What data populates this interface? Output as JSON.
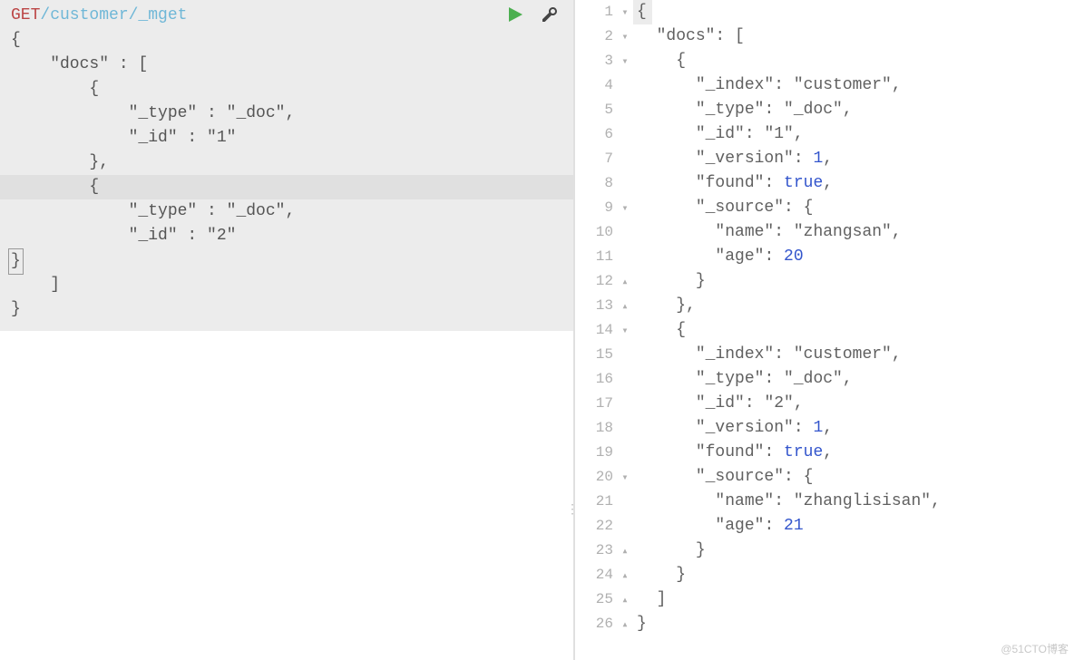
{
  "request": {
    "method": "GET",
    "path": "/customer/_mget",
    "body_lines": [
      "{",
      "    \"docs\" : [",
      "        {",
      "            \"_type\" : \"_doc\",",
      "            \"_id\" : \"1\"",
      "        },",
      "        {",
      "            \"_type\" : \"_doc\",",
      "            \"_id\" : \"2\"",
      "        }",
      "    ]",
      "}"
    ],
    "highlighted_line_index": 7
  },
  "actions": {
    "run": "run-request",
    "tools": "tools-menu"
  },
  "response": {
    "lines": [
      {
        "n": 1,
        "fold": "open",
        "indent": 0,
        "tokens": [
          {
            "t": "{",
            "c": "punc"
          }
        ],
        "hl": true
      },
      {
        "n": 2,
        "fold": "open",
        "indent": 1,
        "tokens": [
          {
            "t": "\"docs\"",
            "c": "key"
          },
          {
            "t": ": [",
            "c": "punc"
          }
        ]
      },
      {
        "n": 3,
        "fold": "open",
        "indent": 2,
        "tokens": [
          {
            "t": "{",
            "c": "punc"
          }
        ]
      },
      {
        "n": 4,
        "fold": "",
        "indent": 3,
        "tokens": [
          {
            "t": "\"_index\"",
            "c": "key"
          },
          {
            "t": ": ",
            "c": "punc"
          },
          {
            "t": "\"customer\"",
            "c": "str"
          },
          {
            "t": ",",
            "c": "punc"
          }
        ]
      },
      {
        "n": 5,
        "fold": "",
        "indent": 3,
        "tokens": [
          {
            "t": "\"_type\"",
            "c": "key"
          },
          {
            "t": ": ",
            "c": "punc"
          },
          {
            "t": "\"_doc\"",
            "c": "str"
          },
          {
            "t": ",",
            "c": "punc"
          }
        ]
      },
      {
        "n": 6,
        "fold": "",
        "indent": 3,
        "tokens": [
          {
            "t": "\"_id\"",
            "c": "key"
          },
          {
            "t": ": ",
            "c": "punc"
          },
          {
            "t": "\"1\"",
            "c": "str"
          },
          {
            "t": ",",
            "c": "punc"
          }
        ]
      },
      {
        "n": 7,
        "fold": "",
        "indent": 3,
        "tokens": [
          {
            "t": "\"_version\"",
            "c": "key"
          },
          {
            "t": ": ",
            "c": "punc"
          },
          {
            "t": "1",
            "c": "num"
          },
          {
            "t": ",",
            "c": "punc"
          }
        ]
      },
      {
        "n": 8,
        "fold": "",
        "indent": 3,
        "tokens": [
          {
            "t": "\"found\"",
            "c": "key"
          },
          {
            "t": ": ",
            "c": "punc"
          },
          {
            "t": "true",
            "c": "bool"
          },
          {
            "t": ",",
            "c": "punc"
          }
        ]
      },
      {
        "n": 9,
        "fold": "open",
        "indent": 3,
        "tokens": [
          {
            "t": "\"_source\"",
            "c": "key"
          },
          {
            "t": ": {",
            "c": "punc"
          }
        ]
      },
      {
        "n": 10,
        "fold": "",
        "indent": 4,
        "tokens": [
          {
            "t": "\"name\"",
            "c": "key"
          },
          {
            "t": ": ",
            "c": "punc"
          },
          {
            "t": "\"zhangsan\"",
            "c": "str"
          },
          {
            "t": ",",
            "c": "punc"
          }
        ]
      },
      {
        "n": 11,
        "fold": "",
        "indent": 4,
        "tokens": [
          {
            "t": "\"age\"",
            "c": "key"
          },
          {
            "t": ": ",
            "c": "punc"
          },
          {
            "t": "20",
            "c": "num"
          }
        ]
      },
      {
        "n": 12,
        "fold": "close",
        "indent": 3,
        "tokens": [
          {
            "t": "}",
            "c": "punc"
          }
        ]
      },
      {
        "n": 13,
        "fold": "close",
        "indent": 2,
        "tokens": [
          {
            "t": "},",
            "c": "punc"
          }
        ]
      },
      {
        "n": 14,
        "fold": "open",
        "indent": 2,
        "tokens": [
          {
            "t": "{",
            "c": "punc"
          }
        ]
      },
      {
        "n": 15,
        "fold": "",
        "indent": 3,
        "tokens": [
          {
            "t": "\"_index\"",
            "c": "key"
          },
          {
            "t": ": ",
            "c": "punc"
          },
          {
            "t": "\"customer\"",
            "c": "str"
          },
          {
            "t": ",",
            "c": "punc"
          }
        ]
      },
      {
        "n": 16,
        "fold": "",
        "indent": 3,
        "tokens": [
          {
            "t": "\"_type\"",
            "c": "key"
          },
          {
            "t": ": ",
            "c": "punc"
          },
          {
            "t": "\"_doc\"",
            "c": "str"
          },
          {
            "t": ",",
            "c": "punc"
          }
        ]
      },
      {
        "n": 17,
        "fold": "",
        "indent": 3,
        "tokens": [
          {
            "t": "\"_id\"",
            "c": "key"
          },
          {
            "t": ": ",
            "c": "punc"
          },
          {
            "t": "\"2\"",
            "c": "str"
          },
          {
            "t": ",",
            "c": "punc"
          }
        ]
      },
      {
        "n": 18,
        "fold": "",
        "indent": 3,
        "tokens": [
          {
            "t": "\"_version\"",
            "c": "key"
          },
          {
            "t": ": ",
            "c": "punc"
          },
          {
            "t": "1",
            "c": "num"
          },
          {
            "t": ",",
            "c": "punc"
          }
        ]
      },
      {
        "n": 19,
        "fold": "",
        "indent": 3,
        "tokens": [
          {
            "t": "\"found\"",
            "c": "key"
          },
          {
            "t": ": ",
            "c": "punc"
          },
          {
            "t": "true",
            "c": "bool"
          },
          {
            "t": ",",
            "c": "punc"
          }
        ]
      },
      {
        "n": 20,
        "fold": "open",
        "indent": 3,
        "tokens": [
          {
            "t": "\"_source\"",
            "c": "key"
          },
          {
            "t": ": {",
            "c": "punc"
          }
        ]
      },
      {
        "n": 21,
        "fold": "",
        "indent": 4,
        "tokens": [
          {
            "t": "\"name\"",
            "c": "key"
          },
          {
            "t": ": ",
            "c": "punc"
          },
          {
            "t": "\"zhanglisisan\"",
            "c": "str"
          },
          {
            "t": ",",
            "c": "punc"
          }
        ]
      },
      {
        "n": 22,
        "fold": "",
        "indent": 4,
        "tokens": [
          {
            "t": "\"age\"",
            "c": "key"
          },
          {
            "t": ": ",
            "c": "punc"
          },
          {
            "t": "21",
            "c": "num"
          }
        ]
      },
      {
        "n": 23,
        "fold": "close",
        "indent": 3,
        "tokens": [
          {
            "t": "}",
            "c": "punc"
          }
        ]
      },
      {
        "n": 24,
        "fold": "close",
        "indent": 2,
        "tokens": [
          {
            "t": "}",
            "c": "punc"
          }
        ]
      },
      {
        "n": 25,
        "fold": "close",
        "indent": 1,
        "tokens": [
          {
            "t": "]",
            "c": "punc"
          }
        ]
      },
      {
        "n": 26,
        "fold": "close",
        "indent": 0,
        "tokens": [
          {
            "t": "}",
            "c": "punc"
          }
        ]
      }
    ]
  },
  "watermark": "@51CTO博客"
}
